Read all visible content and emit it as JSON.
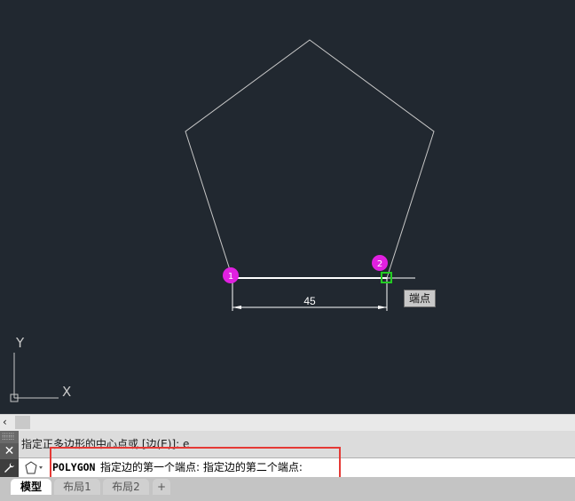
{
  "drawing": {
    "dimension_text": "45",
    "marker_1": "1",
    "marker_2": "2",
    "snap_tooltip": "端点",
    "ucs_x_label": "X",
    "ucs_y_label": "Y",
    "colors": {
      "background": "#212830",
      "polygon_edge": "#c8c8c8",
      "marker": "#e020e0",
      "snap_marker": "#22cc22"
    }
  },
  "scrollbar": {
    "left_arrow": "‹"
  },
  "command_line": {
    "history_text": "指定正多边形的中心点或 [边(E)]: e",
    "close_icon": "✕",
    "customize_icon": "wrench-icon",
    "command_name": "POLYGON",
    "prompt_text": "指定边的第一个端点: 指定边的第二个端点:"
  },
  "layout_tabs": {
    "items": [
      {
        "label": "模型",
        "active": true
      },
      {
        "label": "布局1",
        "active": false
      },
      {
        "label": "布局2",
        "active": false
      }
    ],
    "add_label": "+"
  }
}
